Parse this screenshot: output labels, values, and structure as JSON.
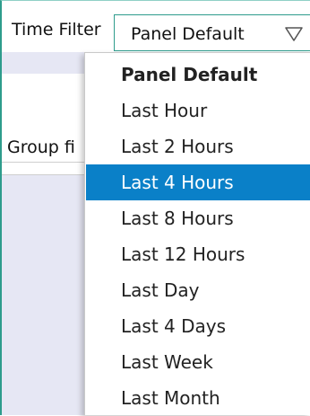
{
  "time_filter": {
    "label": "Time Filter",
    "selected_value": "Panel Default"
  },
  "group_filter": {
    "label": "Group fi"
  },
  "dropdown": {
    "highlighted": "Last 4 Hours",
    "options": [
      "Panel Default",
      "Last Hour",
      "Last 2 Hours",
      "Last 4 Hours",
      "Last 8 Hours",
      "Last 12 Hours",
      "Last Day",
      "Last 4 Days",
      "Last Week",
      "Last Month"
    ]
  },
  "colors": {
    "frame_border": "#2e9c8c",
    "highlight": "#0a80c8",
    "band": "#e6e7f4"
  },
  "icons": {
    "select_arrow": "triangle-down-outline-icon"
  }
}
